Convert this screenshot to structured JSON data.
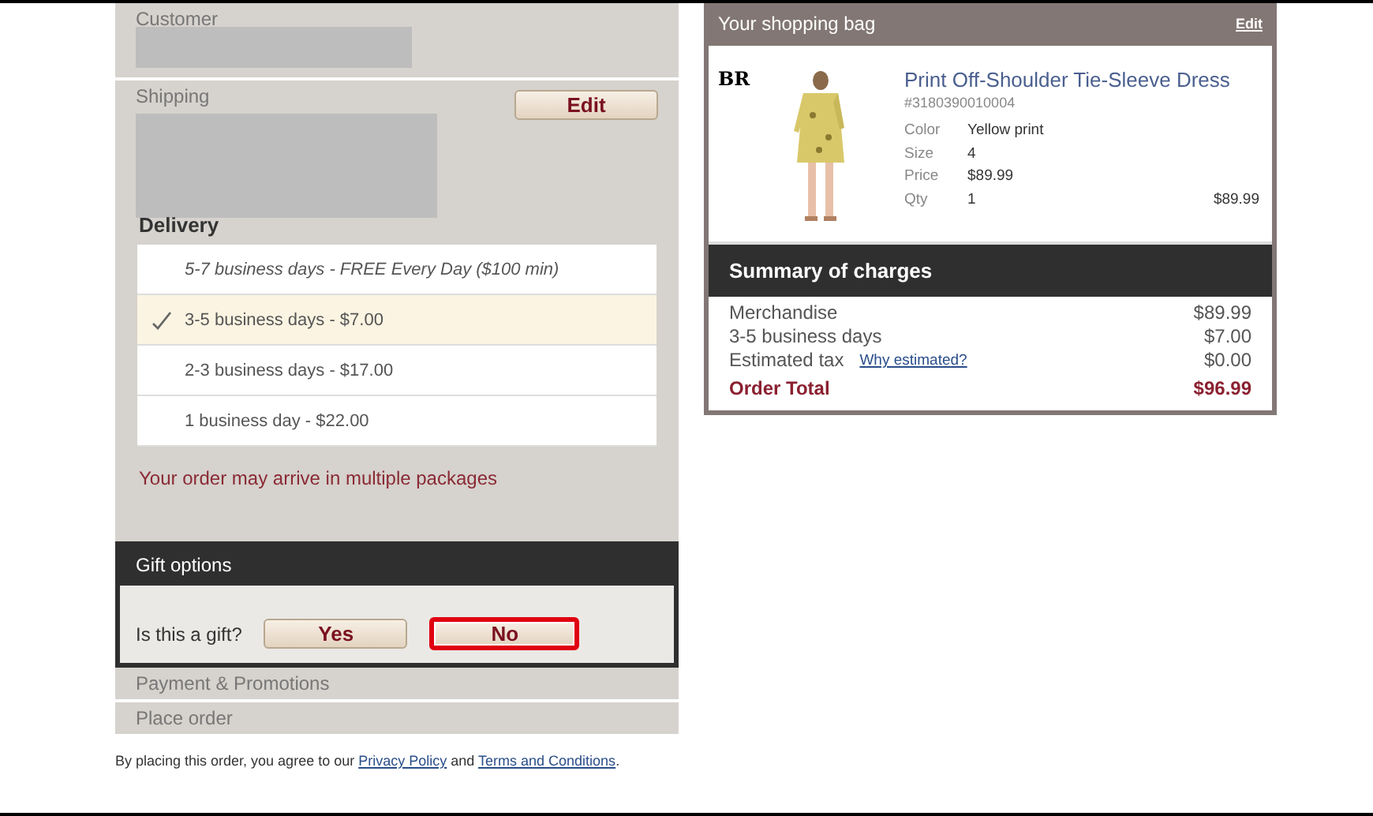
{
  "customer": {
    "title": "Customer"
  },
  "shipping": {
    "title": "Shipping",
    "edit_button": "Edit"
  },
  "delivery": {
    "title": "Delivery",
    "options": [
      {
        "label": "5-7 business days - FREE Every Day ($100 min)",
        "italic": true,
        "selected": false
      },
      {
        "label": "3-5 business days - $7.00",
        "italic": false,
        "selected": true
      },
      {
        "label": "2-3 business days - $17.00",
        "italic": false,
        "selected": false
      },
      {
        "label": "1 business day - $22.00",
        "italic": false,
        "selected": false
      }
    ],
    "note": "Your order may arrive in multiple packages"
  },
  "gift_options": {
    "title": "Gift options",
    "question": "Is this a gift?",
    "choices": [
      {
        "label": "Yes",
        "selected": false
      },
      {
        "label": "No",
        "selected": true
      }
    ]
  },
  "collapsed_sections": [
    "Payment & Promotions",
    "Place order"
  ],
  "agreement": {
    "before": "By placing this order, you agree to our",
    "link_1": "Privacy Policy",
    "middle": "and",
    "link_2": "Terms and Conditions",
    "after": "."
  },
  "bag": {
    "title": "Your shopping bag",
    "edit_link": "Edit",
    "item": {
      "brand_mark": "BR",
      "kind": "picture",
      "name": "Print Off-Shoulder Tie-Sleeve Dress",
      "sku": "#3180390010004",
      "attributes": [
        {
          "label": "Color",
          "value": "Yellow print"
        },
        {
          "label": "Size",
          "value": "4"
        },
        {
          "label": "Price",
          "value": "$89.99"
        },
        {
          "label": "Qty",
          "value": "1"
        }
      ],
      "line_total": "$89.99"
    }
  },
  "summary": {
    "title": "Summary of charges",
    "rows": [
      {
        "label": "Merchandise",
        "value": "$89.99"
      },
      {
        "label": "3-5 business days",
        "value": "$7.00"
      },
      {
        "label": "Estimated tax",
        "link": "Why estimated?",
        "value": "$0.00"
      }
    ],
    "total": {
      "label": "Order Total",
      "value": "$96.99"
    }
  }
}
